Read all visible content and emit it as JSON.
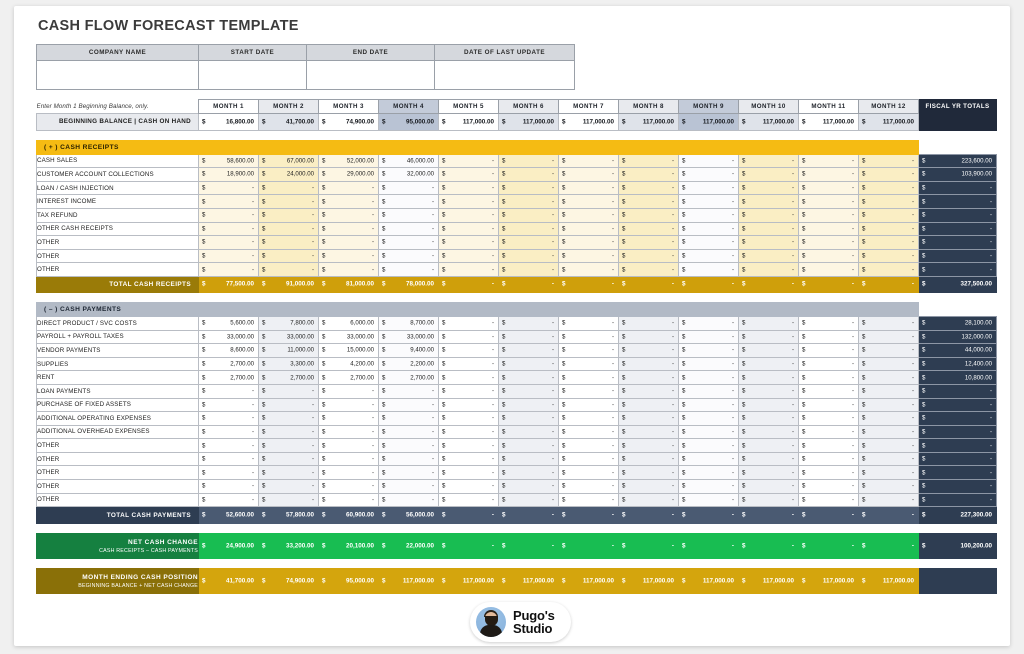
{
  "title": "CASH FLOW FORECAST TEMPLATE",
  "info_headers": [
    "COMPANY NAME",
    "START DATE",
    "END DATE",
    "DATE OF LAST UPDATE"
  ],
  "info_values": [
    "",
    "",
    "",
    ""
  ],
  "note": "Enter Month 1 Beginning Balance, only.",
  "months": [
    "MONTH 1",
    "MONTH 2",
    "MONTH 3",
    "MONTH 4",
    "MONTH 5",
    "MONTH 6",
    "MONTH 7",
    "MONTH 8",
    "MONTH 9",
    "MONTH 10",
    "MONTH 11",
    "MONTH 12"
  ],
  "fiscal_header": "FISCAL YR TOTALS",
  "currency_symbol": "$",
  "dash": "-",
  "beginning_balance": {
    "label": "BEGINNING BALANCE  |  CASH ON HAND",
    "values": [
      "16,800.00",
      "41,700.00",
      "74,900.00",
      "95,000.00",
      "117,000.00",
      "117,000.00",
      "117,000.00",
      "117,000.00",
      "117,000.00",
      "117,000.00",
      "117,000.00",
      "117,000.00"
    ],
    "total": ""
  },
  "receipts": {
    "header": "( + )  CASH RECEIPTS",
    "rows": [
      {
        "label": "CASH SALES",
        "values": [
          "58,600.00",
          "67,000.00",
          "52,000.00",
          "46,000.00",
          "-",
          "-",
          "-",
          "-",
          "-",
          "-",
          "-",
          "-"
        ],
        "total": "223,600.00"
      },
      {
        "label": "CUSTOMER ACCOUNT COLLECTIONS",
        "values": [
          "18,900.00",
          "24,000.00",
          "29,000.00",
          "32,000.00",
          "-",
          "-",
          "-",
          "-",
          "-",
          "-",
          "-",
          "-"
        ],
        "total": "103,900.00"
      },
      {
        "label": "LOAN / CASH INJECTION",
        "values": [
          "-",
          "-",
          "-",
          "-",
          "-",
          "-",
          "-",
          "-",
          "-",
          "-",
          "-",
          "-"
        ],
        "total": "-"
      },
      {
        "label": "INTEREST INCOME",
        "values": [
          "-",
          "-",
          "-",
          "-",
          "-",
          "-",
          "-",
          "-",
          "-",
          "-",
          "-",
          "-"
        ],
        "total": "-"
      },
      {
        "label": "TAX REFUND",
        "values": [
          "-",
          "-",
          "-",
          "-",
          "-",
          "-",
          "-",
          "-",
          "-",
          "-",
          "-",
          "-"
        ],
        "total": "-"
      },
      {
        "label": "OTHER CASH RECEIPTS",
        "values": [
          "-",
          "-",
          "-",
          "-",
          "-",
          "-",
          "-",
          "-",
          "-",
          "-",
          "-",
          "-"
        ],
        "total": "-"
      },
      {
        "label": "OTHER",
        "values": [
          "-",
          "-",
          "-",
          "-",
          "-",
          "-",
          "-",
          "-",
          "-",
          "-",
          "-",
          "-"
        ],
        "total": "-"
      },
      {
        "label": "OTHER",
        "values": [
          "-",
          "-",
          "-",
          "-",
          "-",
          "-",
          "-",
          "-",
          "-",
          "-",
          "-",
          "-"
        ],
        "total": "-"
      },
      {
        "label": "OTHER",
        "values": [
          "-",
          "-",
          "-",
          "-",
          "-",
          "-",
          "-",
          "-",
          "-",
          "-",
          "-",
          "-"
        ],
        "total": "-"
      }
    ],
    "total_row": {
      "label": "TOTAL CASH RECEIPTS",
      "values": [
        "77,500.00",
        "91,000.00",
        "81,000.00",
        "78,000.00",
        "-",
        "-",
        "-",
        "-",
        "-",
        "-",
        "-",
        "-"
      ],
      "total": "327,500.00"
    }
  },
  "payments": {
    "header": "( – )  CASH PAYMENTS",
    "rows": [
      {
        "label": "DIRECT PRODUCT / SVC COSTS",
        "values": [
          "5,600.00",
          "7,800.00",
          "6,000.00",
          "8,700.00",
          "-",
          "-",
          "-",
          "-",
          "-",
          "-",
          "-",
          "-"
        ],
        "total": "28,100.00"
      },
      {
        "label": "PAYROLL + PAYROLL TAXES",
        "values": [
          "33,000.00",
          "33,000.00",
          "33,000.00",
          "33,000.00",
          "-",
          "-",
          "-",
          "-",
          "-",
          "-",
          "-",
          "-"
        ],
        "total": "132,000.00"
      },
      {
        "label": "VENDOR PAYMENTS",
        "values": [
          "8,600.00",
          "11,000.00",
          "15,000.00",
          "9,400.00",
          "-",
          "-",
          "-",
          "-",
          "-",
          "-",
          "-",
          "-"
        ],
        "total": "44,000.00"
      },
      {
        "label": "SUPPLIES",
        "values": [
          "2,700.00",
          "3,300.00",
          "4,200.00",
          "2,200.00",
          "-",
          "-",
          "-",
          "-",
          "-",
          "-",
          "-",
          "-"
        ],
        "total": "12,400.00"
      },
      {
        "label": "RENT",
        "values": [
          "2,700.00",
          "2,700.00",
          "2,700.00",
          "2,700.00",
          "-",
          "-",
          "-",
          "-",
          "-",
          "-",
          "-",
          "-"
        ],
        "total": "10,800.00"
      },
      {
        "label": "LOAN PAYMENTS",
        "values": [
          "-",
          "-",
          "-",
          "-",
          "-",
          "-",
          "-",
          "-",
          "-",
          "-",
          "-",
          "-"
        ],
        "total": "-"
      },
      {
        "label": "PURCHASE OF FIXED ASSETS",
        "values": [
          "-",
          "-",
          "-",
          "-",
          "-",
          "-",
          "-",
          "-",
          "-",
          "-",
          "-",
          "-"
        ],
        "total": "-"
      },
      {
        "label": "ADDITIONAL OPERATING EXPENSES",
        "values": [
          "-",
          "-",
          "-",
          "-",
          "-",
          "-",
          "-",
          "-",
          "-",
          "-",
          "-",
          "-"
        ],
        "total": "-"
      },
      {
        "label": "ADDITIONAL OVERHEAD EXPENSES",
        "values": [
          "-",
          "-",
          "-",
          "-",
          "-",
          "-",
          "-",
          "-",
          "-",
          "-",
          "-",
          "-"
        ],
        "total": "-"
      },
      {
        "label": "OTHER",
        "values": [
          "-",
          "-",
          "-",
          "-",
          "-",
          "-",
          "-",
          "-",
          "-",
          "-",
          "-",
          "-"
        ],
        "total": "-"
      },
      {
        "label": "OTHER",
        "values": [
          "-",
          "-",
          "-",
          "-",
          "-",
          "-",
          "-",
          "-",
          "-",
          "-",
          "-",
          "-"
        ],
        "total": "-"
      },
      {
        "label": "OTHER",
        "values": [
          "-",
          "-",
          "-",
          "-",
          "-",
          "-",
          "-",
          "-",
          "-",
          "-",
          "-",
          "-"
        ],
        "total": "-"
      },
      {
        "label": "OTHER",
        "values": [
          "-",
          "-",
          "-",
          "-",
          "-",
          "-",
          "-",
          "-",
          "-",
          "-",
          "-",
          "-"
        ],
        "total": "-"
      },
      {
        "label": "OTHER",
        "values": [
          "-",
          "-",
          "-",
          "-",
          "-",
          "-",
          "-",
          "-",
          "-",
          "-",
          "-",
          "-"
        ],
        "total": "-"
      }
    ],
    "total_row": {
      "label": "TOTAL CASH PAYMENTS",
      "values": [
        "52,600.00",
        "57,800.00",
        "60,900.00",
        "56,000.00",
        "-",
        "-",
        "-",
        "-",
        "-",
        "-",
        "-",
        "-"
      ],
      "total": "227,300.00"
    }
  },
  "net_cash_change": {
    "label": "NET CASH CHANGE",
    "sublabel": "CASH RECEIPTS – CASH PAYMENTS",
    "values": [
      "24,900.00",
      "33,200.00",
      "20,100.00",
      "22,000.00",
      "-",
      "-",
      "-",
      "-",
      "-",
      "-",
      "-",
      "-"
    ],
    "total": "100,200.00"
  },
  "month_ending": {
    "label": "MONTH ENDING CASH POSITION",
    "sublabel": "BEGINNING BALANCE + NET CASH CHANGE",
    "values": [
      "41,700.00",
      "74,900.00",
      "95,000.00",
      "117,000.00",
      "117,000.00",
      "117,000.00",
      "117,000.00",
      "117,000.00",
      "117,000.00",
      "117,000.00",
      "117,000.00",
      "117,000.00"
    ],
    "total": ""
  },
  "watermark": {
    "line1": "Pugo's",
    "line2": "Studio"
  },
  "colors": {
    "amber": "#f5bb13",
    "gold": "#cf9f0b",
    "navy": "#2e3d52",
    "green": "#18bd52",
    "dark_green": "#158040",
    "slate": "#b2bac6",
    "fiscal_header_bg": "#20293a"
  }
}
